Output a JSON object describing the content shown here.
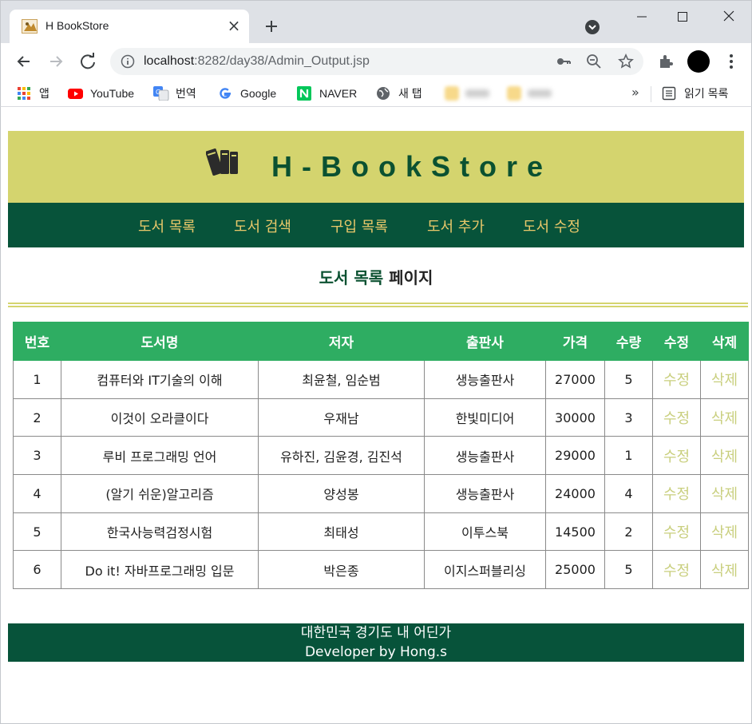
{
  "browser": {
    "tab": {
      "title": "H BookStore",
      "close": "×"
    },
    "url": {
      "host": "localhost",
      "rest": ":8282/day38/Admin_Output.jsp"
    },
    "bookmarks": [
      {
        "label": "앱",
        "icon": "apps-grid-icon"
      },
      {
        "label": "YouTube",
        "icon": "youtube-icon"
      },
      {
        "label": "번역",
        "icon": "translate-icon"
      },
      {
        "label": "Google",
        "icon": "google-icon"
      },
      {
        "label": "NAVER",
        "icon": "naver-icon"
      },
      {
        "label": "새 탭",
        "icon": "globe-icon"
      }
    ],
    "more": "»",
    "reading_list": "읽기 목록"
  },
  "site": {
    "title": "H-BookStore",
    "nav": [
      "도서 목록",
      "도서 검색",
      "구입 목록",
      "도서 추가",
      "도서 수정"
    ],
    "heading_highlight": "도서 목록",
    "heading_rest": " 페이지",
    "table": {
      "headers": [
        "번호",
        "도서명",
        "저자",
        "출판사",
        "가격",
        "수량",
        "수정",
        "삭제"
      ],
      "rows": [
        {
          "no": "1",
          "title": "컴퓨터와 IT기술의 이해",
          "author": "최윤철, 임순범",
          "publisher": "생능출판사",
          "price": "27000",
          "qty": "5",
          "edit": "수정",
          "del": "삭제"
        },
        {
          "no": "2",
          "title": "이것이 오라클이다",
          "author": "우재남",
          "publisher": "한빛미디어",
          "price": "30000",
          "qty": "3",
          "edit": "수정",
          "del": "삭제"
        },
        {
          "no": "3",
          "title": "루비 프로그래밍 언어",
          "author": "유하진, 김윤경, 김진석",
          "publisher": "생능출판사",
          "price": "29000",
          "qty": "1",
          "edit": "수정",
          "del": "삭제"
        },
        {
          "no": "4",
          "title": "(알기 쉬운)알고리즘",
          "author": "양성봉",
          "publisher": "생능출판사",
          "price": "24000",
          "qty": "4",
          "edit": "수정",
          "del": "삭제"
        },
        {
          "no": "5",
          "title": "한국사능력검정시험",
          "author": "최태성",
          "publisher": "이투스북",
          "price": "14500",
          "qty": "2",
          "edit": "수정",
          "del": "삭제"
        },
        {
          "no": "6",
          "title": "Do it! 자바프로그래밍 입문",
          "author": "박은종",
          "publisher": "이지스퍼블리싱",
          "price": "25000",
          "qty": "5",
          "edit": "수정",
          "del": "삭제"
        }
      ]
    },
    "footer": {
      "line1": "대한민국 경기도 내 어딘가",
      "line2": "Developer by Hong.s"
    }
  },
  "colors": {
    "header_bg": "#d4d46e",
    "nav_bg": "#07533a",
    "nav_text": "#e9c86a",
    "title_text": "#0b5131",
    "table_header_bg": "#2ead62",
    "action_link": "#c9cf7e"
  }
}
